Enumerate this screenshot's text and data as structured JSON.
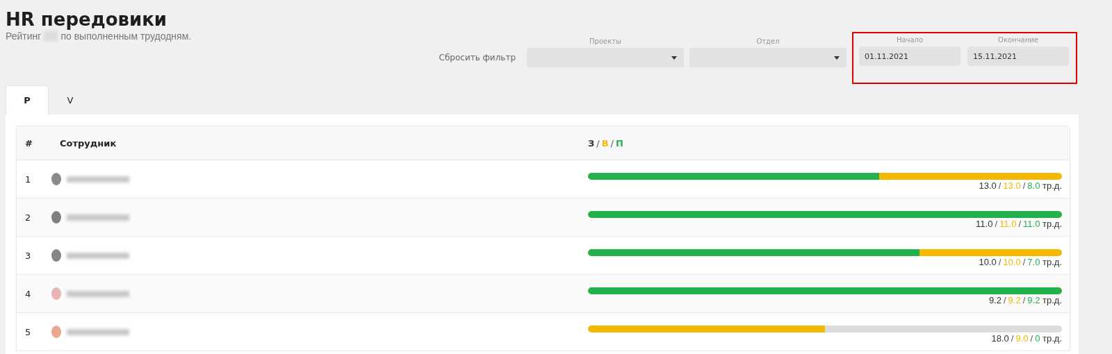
{
  "page": {
    "title": "HR передовики",
    "subtitle_start": "Рейтинг",
    "subtitle_end": "по выполненным трудодням."
  },
  "filters": {
    "reset": "Сбросить фильтр",
    "selects": [
      {
        "label": "Проекты"
      },
      {
        "label": "Отдел"
      }
    ],
    "dates": {
      "highlighted": true,
      "fields": [
        {
          "label": "Начало",
          "value": "01.11.2021"
        },
        {
          "label": "Окончание",
          "value": "15.11.2021"
        }
      ]
    }
  },
  "tabs": [
    {
      "label": "Р",
      "selected": true
    },
    {
      "label": "V",
      "selected": false
    }
  ],
  "table": {
    "columns": [
      "#",
      "Сотрудник"
    ],
    "legend": [
      {
        "kind": "planned",
        "label": "З"
      },
      {
        "kind": "booked",
        "label": "В"
      },
      {
        "kind": "done",
        "label": "П"
      }
    ],
    "unit_separator": "/",
    "rows": [
      {
        "rank": "1",
        "color": "#8a8a8a",
        "segments": [
          {
            "kind": "booked",
            "level": 1
          },
          {
            "kind": "done",
            "level": 0.615
          }
        ],
        "values": [
          {
            "kind": "planned",
            "text": "13.0"
          },
          {
            "kind": "booked",
            "text": "13.0"
          },
          {
            "kind": "done",
            "text": "8.0"
          }
        ],
        "unit": "тр.д."
      },
      {
        "rank": "2",
        "color": "#7f7f7f",
        "segments": [
          {
            "kind": "booked",
            "level": 1
          },
          {
            "kind": "done",
            "level": 1
          }
        ],
        "values": [
          {
            "kind": "planned",
            "text": "11.0"
          },
          {
            "kind": "booked",
            "text": "11.0"
          },
          {
            "kind": "done",
            "text": "11.0"
          }
        ],
        "unit": "тр.д."
      },
      {
        "rank": "3",
        "color": "#858585",
        "segments": [
          {
            "kind": "booked",
            "level": 1
          },
          {
            "kind": "done",
            "level": 0.7
          }
        ],
        "values": [
          {
            "kind": "planned",
            "text": "10.0"
          },
          {
            "kind": "booked",
            "text": "10.0"
          },
          {
            "kind": "done",
            "text": "7.0"
          }
        ],
        "unit": "тр.д."
      },
      {
        "rank": "4",
        "color": "#e8b4b4",
        "segments": [
          {
            "kind": "booked",
            "level": 1
          },
          {
            "kind": "done",
            "level": 1
          }
        ],
        "values": [
          {
            "kind": "planned",
            "text": "9.2"
          },
          {
            "kind": "booked",
            "text": "9.2"
          },
          {
            "kind": "done",
            "text": "9.2"
          }
        ],
        "unit": "тр.д."
      },
      {
        "rank": "5",
        "color": "#e9a98e",
        "segments": [
          {
            "kind": "booked",
            "level": 0.5
          },
          {
            "kind": "done",
            "level": 0
          }
        ],
        "values": [
          {
            "kind": "planned",
            "text": "18.0"
          },
          {
            "kind": "booked",
            "text": "9.0"
          },
          {
            "kind": "done",
            "text": "0"
          }
        ],
        "unit": "тр.д."
      }
    ]
  }
}
